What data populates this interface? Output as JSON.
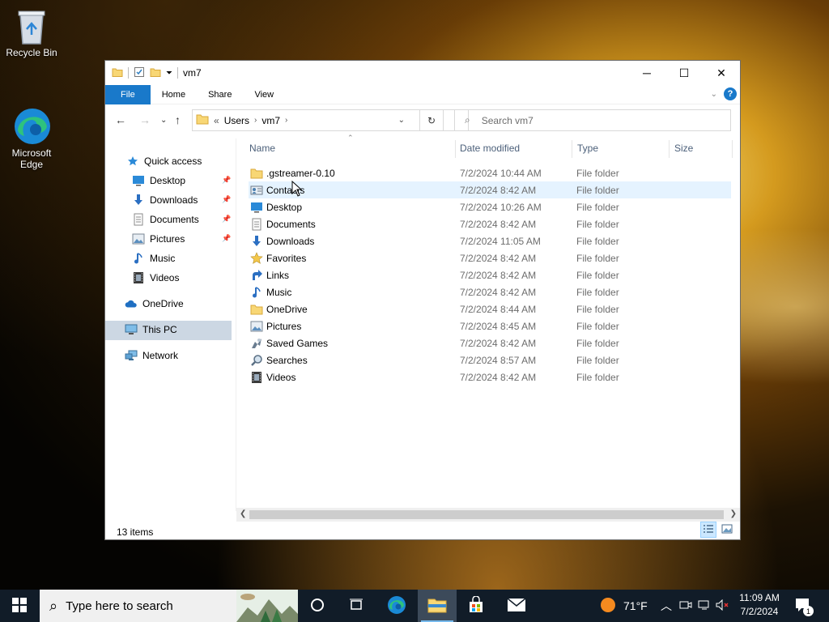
{
  "desktop": {
    "icons": [
      {
        "label": "Recycle Bin",
        "icon": "recycle-bin-icon"
      },
      {
        "label": "Microsoft\nEdge",
        "icon": "edge-icon"
      }
    ]
  },
  "window": {
    "title": "vm7",
    "ribbon_tabs": [
      "File",
      "Home",
      "Share",
      "View"
    ],
    "address": {
      "crumbs": [
        "Users",
        "vm7"
      ]
    },
    "search_placeholder": "Search vm7",
    "nav": {
      "quick_access": "Quick access",
      "pinned": [
        {
          "label": "Desktop",
          "icon": "desktop-folder-icon"
        },
        {
          "label": "Downloads",
          "icon": "downloads-icon"
        },
        {
          "label": "Documents",
          "icon": "documents-icon"
        },
        {
          "label": "Pictures",
          "icon": "pictures-icon"
        },
        {
          "label": "Music",
          "icon": "music-icon"
        },
        {
          "label": "Videos",
          "icon": "videos-icon"
        }
      ],
      "onedrive": "OneDrive",
      "this_pc": "This PC",
      "network": "Network"
    },
    "columns": {
      "name": "Name",
      "date": "Date modified",
      "type": "Type",
      "size": "Size"
    },
    "files": [
      {
        "name": ".gstreamer-0.10",
        "date": "7/2/2024 10:44 AM",
        "type": "File folder",
        "icon": "folder-icon"
      },
      {
        "name": "Contacts",
        "date": "7/2/2024 8:42 AM",
        "type": "File folder",
        "icon": "contacts-icon"
      },
      {
        "name": "Desktop",
        "date": "7/2/2024 10:26 AM",
        "type": "File folder",
        "icon": "desktop-folder-icon"
      },
      {
        "name": "Documents",
        "date": "7/2/2024 8:42 AM",
        "type": "File folder",
        "icon": "documents-icon"
      },
      {
        "name": "Downloads",
        "date": "7/2/2024 11:05 AM",
        "type": "File folder",
        "icon": "downloads-icon"
      },
      {
        "name": "Favorites",
        "date": "7/2/2024 8:42 AM",
        "type": "File folder",
        "icon": "favorites-icon"
      },
      {
        "name": "Links",
        "date": "7/2/2024 8:42 AM",
        "type": "File folder",
        "icon": "links-icon"
      },
      {
        "name": "Music",
        "date": "7/2/2024 8:42 AM",
        "type": "File folder",
        "icon": "music-icon"
      },
      {
        "name": "OneDrive",
        "date": "7/2/2024 8:44 AM",
        "type": "File folder",
        "icon": "folder-icon"
      },
      {
        "name": "Pictures",
        "date": "7/2/2024 8:45 AM",
        "type": "File folder",
        "icon": "pictures-icon"
      },
      {
        "name": "Saved Games",
        "date": "7/2/2024 8:42 AM",
        "type": "File folder",
        "icon": "saved-games-icon"
      },
      {
        "name": "Searches",
        "date": "7/2/2024 8:57 AM",
        "type": "File folder",
        "icon": "searches-icon"
      },
      {
        "name": "Videos",
        "date": "7/2/2024 8:42 AM",
        "type": "File folder",
        "icon": "videos-icon"
      }
    ],
    "status": "13 items"
  },
  "taskbar": {
    "search_placeholder": "Type here to search",
    "weather": "71°F",
    "time": "11:09 AM",
    "date": "7/2/2024",
    "notification_count": "1"
  },
  "colors": {
    "accent": "#1979ca",
    "selection": "#ccd7e3",
    "hover": "#e5f3ff",
    "folder": "#f8d775"
  }
}
